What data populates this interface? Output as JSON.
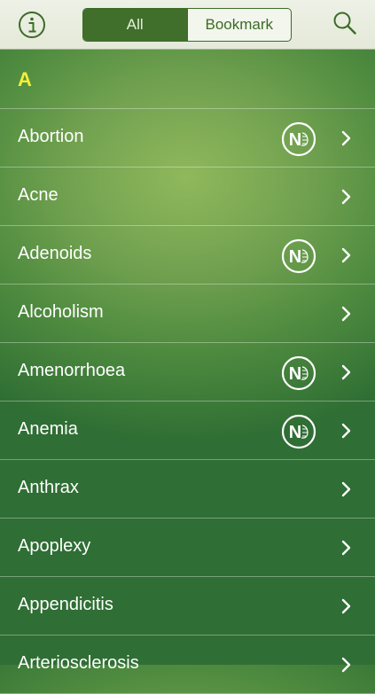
{
  "header": {
    "info_icon": "info-circle-icon",
    "search_icon": "search-icon",
    "segments": [
      {
        "label": "All",
        "active": true
      },
      {
        "label": "Bookmark",
        "active": false
      }
    ]
  },
  "section": {
    "letter": "A"
  },
  "items": [
    {
      "label": "Abortion",
      "badge": true
    },
    {
      "label": "Acne",
      "badge": false
    },
    {
      "label": "Adenoids",
      "badge": true
    },
    {
      "label": "Alcoholism",
      "badge": false
    },
    {
      "label": "Amenorrhoea",
      "badge": true
    },
    {
      "label": "Anemia",
      "badge": true
    },
    {
      "label": "Anthrax",
      "badge": false
    },
    {
      "label": "Apoplexy",
      "badge": false
    },
    {
      "label": "Appendicitis",
      "badge": false
    },
    {
      "label": "Arteriosclerosis",
      "badge": false
    }
  ],
  "badge_letter": "N",
  "colors": {
    "section_letter": "#f3ef3a",
    "segment_active": "#3f6f2b"
  }
}
